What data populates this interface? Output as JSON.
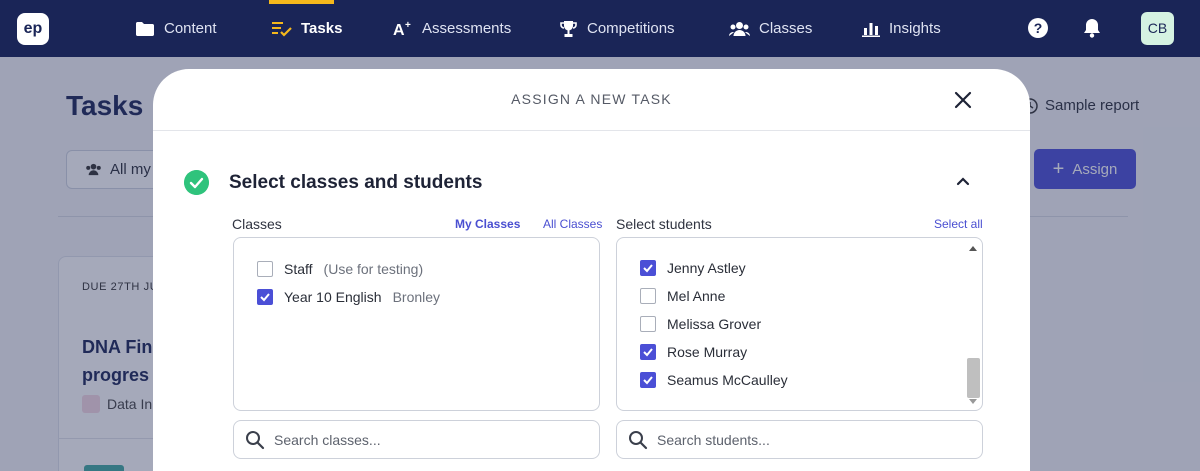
{
  "app": {
    "logo": "ep",
    "avatar": "CB"
  },
  "nav": {
    "items": [
      {
        "label": "Content",
        "icon": "folder-icon"
      },
      {
        "label": "Tasks",
        "icon": "tasks-icon",
        "active": true
      },
      {
        "label": "Assessments",
        "icon": "assessment-icon"
      },
      {
        "label": "Competitions",
        "icon": "trophy-icon"
      },
      {
        "label": "Classes",
        "icon": "people-icon"
      },
      {
        "label": "Insights",
        "icon": "bar-chart-icon"
      }
    ]
  },
  "page": {
    "title": "Tasks",
    "filter_label": "All my",
    "sample_report": "Sample report",
    "assign_label": "Assign",
    "card": {
      "due": "DUE 27TH JU",
      "title": "DNA Fin progres",
      "tag": "Data In"
    }
  },
  "modal": {
    "title": "ASSIGN A NEW TASK",
    "section_title": "Select classes and students",
    "classes": {
      "label": "Classes",
      "my_classes_link": "My Classes",
      "all_classes_link": "All Classes",
      "items": [
        {
          "name": "Staff",
          "note": "(Use for testing)",
          "checked": false
        },
        {
          "name": "Year 10 English",
          "note": "Bronley",
          "checked": true
        }
      ],
      "search_placeholder": "Search classes..."
    },
    "students": {
      "label": "Select students",
      "select_all_link": "Select all",
      "items": [
        {
          "name": "Jenny Astley",
          "checked": true
        },
        {
          "name": "Mel Anne",
          "checked": false
        },
        {
          "name": "Melissa Grover",
          "checked": false
        },
        {
          "name": "Rose Murray",
          "checked": true
        },
        {
          "name": "Seamus McCaulley",
          "checked": true
        }
      ],
      "search_placeholder": "Search students..."
    }
  },
  "colors": {
    "nav_bg": "#1a2557",
    "accent": "#4b4fd6",
    "active_bar": "#f5b81c",
    "success": "#2fc37c"
  }
}
